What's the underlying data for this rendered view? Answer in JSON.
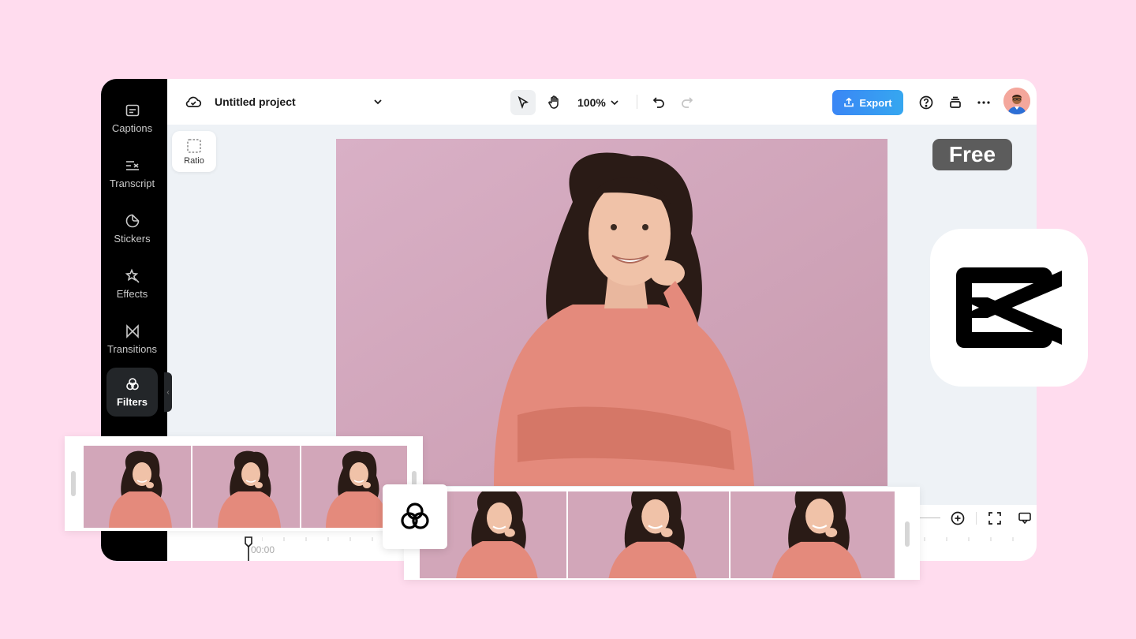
{
  "sidebar": {
    "items": [
      {
        "label": "Captions",
        "icon": "captions-icon"
      },
      {
        "label": "Transcript",
        "icon": "transcript-icon"
      },
      {
        "label": "Stickers",
        "icon": "stickers-icon"
      },
      {
        "label": "Effects",
        "icon": "effects-icon"
      },
      {
        "label": "Transitions",
        "icon": "transitions-icon"
      },
      {
        "label": "Filters",
        "icon": "filters-icon",
        "active": true
      }
    ]
  },
  "header": {
    "project_title": "Untitled project",
    "zoom": "100%",
    "export_label": "Export"
  },
  "canvas": {
    "ratio_label": "Ratio"
  },
  "badge": {
    "free_label": "Free"
  },
  "timeline": {
    "timecode": "00:00"
  },
  "colors": {
    "background": "#ffdcee",
    "export_start": "#3a86f5",
    "export_end": "#36a7f0",
    "sidebar": "#000000",
    "photo_bg": "#d6a9bd",
    "sweater": "#e48a7c"
  }
}
